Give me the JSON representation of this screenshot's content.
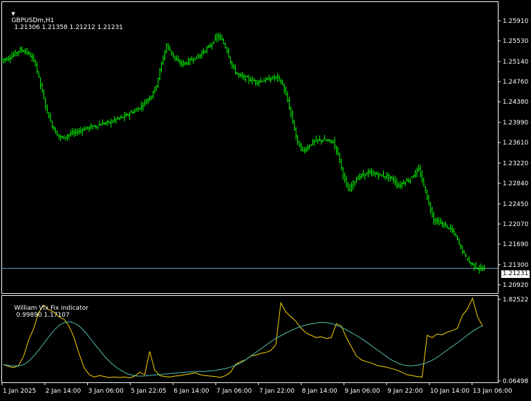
{
  "main_title": {
    "symbol": "GBPUSDm,H1",
    "ohlc": "1.21306 1.21358 1.21212 1.21231"
  },
  "sub_title": {
    "name": "William Vix Fix indicator",
    "values": "0.99890 1.17107"
  },
  "current_price_label": "1.21231",
  "colors": {
    "background": "#000000",
    "candles": "#00ff00",
    "frame": "#ffffff",
    "bid_line": "#7f9fbf",
    "vixfix_line": "#ffd700",
    "ma_line": "#4fc3b4"
  },
  "chart_data": [
    {
      "type": "candlestick",
      "title": "GBPUSDm,H1",
      "ylim": [
        1.2092,
        1.2612
      ],
      "price_ticks": [
        "1.25910",
        "1.25530",
        "1.25140",
        "1.24760",
        "1.24380",
        "1.23990",
        "1.23610",
        "1.23220",
        "1.22840",
        "1.22450",
        "1.22070",
        "1.21690",
        "1.21300",
        "1.20920"
      ],
      "x_ticks": [
        "1 Jan 2025",
        "2 Jan 14:00",
        "3 Jan 06:00",
        "5 Jan 22:05",
        "6 Jan 14:00",
        "7 Jan 06:00",
        "7 Jan 22:00",
        "8 Jan 14:00",
        "9 Jan 06:00",
        "9 Jan 22:00",
        "10 Jan 14:00",
        "13 Jan 06:00"
      ],
      "close_path": [
        1.2518,
        1.2522,
        1.253,
        1.2536,
        1.2534,
        1.2525,
        1.251,
        1.247,
        1.243,
        1.24,
        1.238,
        1.237,
        1.2372,
        1.2378,
        1.238,
        1.2384,
        1.2388,
        1.239,
        1.2392,
        1.2396,
        1.2398,
        1.24,
        1.2405,
        1.2408,
        1.2412,
        1.2418,
        1.2422,
        1.243,
        1.244,
        1.245,
        1.247,
        1.251,
        1.2545,
        1.253,
        1.2515,
        1.251,
        1.2512,
        1.2518,
        1.2522,
        1.253,
        1.2538,
        1.2548,
        1.2562,
        1.2555,
        1.2535,
        1.2505,
        1.249,
        1.2485,
        1.2482,
        1.2478,
        1.2476,
        1.2478,
        1.248,
        1.2483,
        1.2485,
        1.247,
        1.244,
        1.24,
        1.236,
        1.2345,
        1.2352,
        1.2362,
        1.2365,
        1.2366,
        1.2364,
        1.2362,
        1.234,
        1.23,
        1.227,
        1.2285,
        1.2295,
        1.23,
        1.2304,
        1.2302,
        1.23,
        1.2298,
        1.2296,
        1.229,
        1.2278,
        1.2286,
        1.229,
        1.23,
        1.231,
        1.228,
        1.2245,
        1.2215,
        1.221,
        1.2205,
        1.22,
        1.219,
        1.217,
        1.215,
        1.2135,
        1.2128,
        1.2122,
        1.2123
      ],
      "last_price": 1.21231
    },
    {
      "type": "line",
      "title": "William Vix Fix indicator",
      "ylim": [
        0.06498,
        1.82522
      ],
      "y_ticks": [
        "1.82522",
        "0.06498"
      ],
      "series": [
        {
          "name": "",
          "color": "#ffd700",
          "values": [
            0.42,
            0.38,
            0.35,
            0.4,
            0.6,
            0.95,
            1.2,
            1.55,
            1.7,
            1.6,
            1.55,
            1.45,
            1.4,
            1.25,
            1.0,
            0.65,
            0.35,
            0.2,
            0.15,
            0.18,
            0.16,
            0.14,
            0.15,
            0.14,
            0.15,
            0.13,
            0.17,
            0.25,
            0.2,
            0.7,
            0.3,
            0.18,
            0.16,
            0.15,
            0.17,
            0.18,
            0.2,
            0.22,
            0.24,
            0.2,
            0.18,
            0.17,
            0.16,
            0.14,
            0.18,
            0.25,
            0.42,
            0.48,
            0.52,
            0.6,
            0.62,
            0.66,
            0.68,
            0.72,
            0.85,
            1.75,
            1.55,
            1.45,
            1.35,
            1.2,
            1.1,
            1.05,
            1.0,
            1.02,
            0.98,
            1.0,
            1.3,
            1.25,
            1.0,
            0.8,
            0.6,
            0.52,
            0.48,
            0.45,
            0.4,
            0.38,
            0.36,
            0.33,
            0.3,
            0.25,
            0.2,
            0.18,
            0.16,
            0.15,
            1.05,
            1.0,
            1.08,
            1.06,
            1.12,
            1.15,
            1.2,
            1.48,
            1.62,
            1.85,
            1.45,
            1.25
          ]
        },
        {
          "name": "",
          "color": "#4fc3b4",
          "values": [
            0.42,
            0.4,
            0.39,
            0.39,
            0.42,
            0.5,
            0.62,
            0.75,
            0.9,
            1.05,
            1.18,
            1.28,
            1.33,
            1.34,
            1.3,
            1.22,
            1.1,
            0.96,
            0.82,
            0.68,
            0.55,
            0.44,
            0.35,
            0.28,
            0.22,
            0.19,
            0.17,
            0.17,
            0.18,
            0.19,
            0.2,
            0.21,
            0.22,
            0.23,
            0.24,
            0.25,
            0.26,
            0.26,
            0.27,
            0.27,
            0.28,
            0.29,
            0.31,
            0.33,
            0.36,
            0.4,
            0.45,
            0.52,
            0.6,
            0.68,
            0.76,
            0.84,
            0.92,
            0.99,
            1.05,
            1.11,
            1.16,
            1.21,
            1.25,
            1.28,
            1.3,
            1.32,
            1.33,
            1.32,
            1.29,
            1.25,
            1.2,
            1.14,
            1.08,
            1.01,
            0.94,
            0.86,
            0.78,
            0.7,
            0.62,
            0.54,
            0.48,
            0.43,
            0.4,
            0.39,
            0.4,
            0.42,
            0.45,
            0.5,
            0.56,
            0.64,
            0.72,
            0.8,
            0.88,
            0.96,
            1.05,
            1.13,
            1.2,
            1.26
          ]
        }
      ]
    }
  ]
}
